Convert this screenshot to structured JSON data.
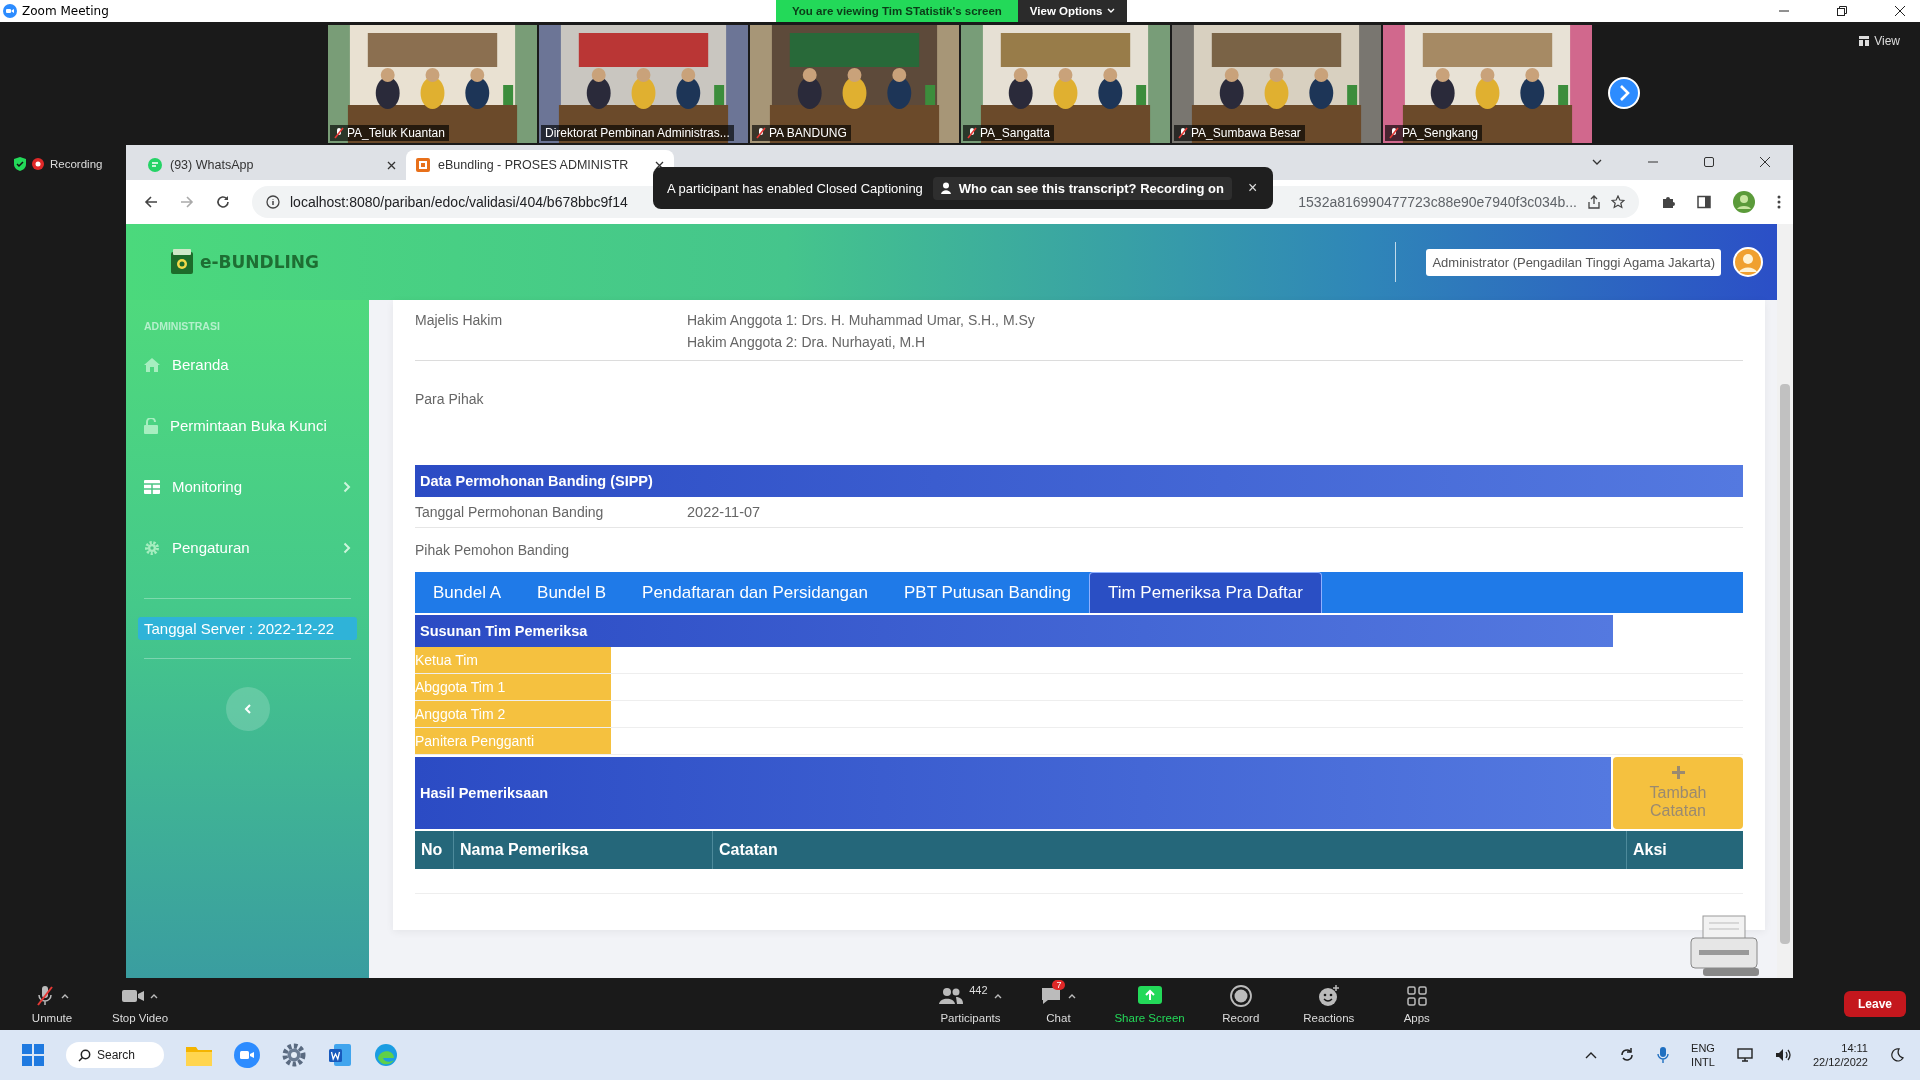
{
  "zoom_window": {
    "title": "Zoom Meeting",
    "banner": "You are viewing Tim STatistik's screen",
    "view_options": "View Options",
    "view": "View",
    "recording": "Recording"
  },
  "video_tiles": [
    {
      "name": "PA_Teluk Kuantan",
      "muted": true
    },
    {
      "name": "Direktorat Pembinan Administras...",
      "muted": false
    },
    {
      "name": "PA BANDUNG",
      "muted": true
    },
    {
      "name": "PA_Sangatta",
      "muted": true
    },
    {
      "name": "PA_Sumbawa Besar",
      "muted": true
    },
    {
      "name": "PA_Sengkang",
      "muted": true
    }
  ],
  "browser": {
    "tabs": [
      {
        "title": "(93) WhatsApp",
        "kind": "whatsapp",
        "selected": false
      },
      {
        "title": "eBundling - PROSES ADMINISTR",
        "kind": "ebundling",
        "selected": true
      }
    ],
    "url_start": "localhost:8080/pariban/edoc/validasi/404/b678bbc9f14",
    "url_end": "1532a816990477723c88e90e7940f3c034b..."
  },
  "caption_banner": {
    "text": "A participant has enabled Closed Captioning",
    "link": "Who can see this transcript? Recording on",
    "close": "×"
  },
  "app": {
    "logo": "e-BUNDLING",
    "user": "Administrator (Pengadilan Tinggi Agama Jakarta)"
  },
  "sidebar": {
    "section": "ADMINISTRASI",
    "items": [
      {
        "label": "Beranda",
        "kind": "home",
        "submenu": false
      },
      {
        "label": "Permintaan Buka Kunci",
        "kind": "lock",
        "submenu": false
      },
      {
        "label": "Monitoring",
        "kind": "grid",
        "submenu": true
      },
      {
        "label": "Pengaturan",
        "kind": "gear",
        "submenu": true
      }
    ],
    "server_date": "Tanggal Server : 2022-12-22"
  },
  "detail_rows": [
    {
      "label": "Majelis Hakim",
      "values": [
        "Hakim Anggota 1: Drs. H. Muhammad Umar, S.H., M.Sy",
        "Hakim Anggota 2: Dra. Nurhayati, M.H"
      ]
    },
    {
      "label": "Para Pihak"
    }
  ],
  "sipp": {
    "title": "Data Permohonan Banding (SIPP)",
    "rows": [
      {
        "label": "Tanggal Permohonan Banding",
        "value": "2022-11-07"
      },
      {
        "label": "Pihak Pemohon Banding"
      }
    ]
  },
  "tabs": [
    {
      "label": "Bundel A",
      "selected": false
    },
    {
      "label": "Bundel B",
      "selected": false
    },
    {
      "label": "Pendaftaran dan Persidangan",
      "selected": false
    },
    {
      "label": "PBT Putusan Banding",
      "selected": false
    },
    {
      "label": "Tim Pemeriksa Pra Daftar",
      "selected": true
    }
  ],
  "team": {
    "title": "Susunan Tim Pemeriksa",
    "roles": [
      "Ketua Tim",
      "Abggota Tim 1",
      "Anggota Tim 2",
      "Panitera Pengganti"
    ]
  },
  "results": {
    "title": "Hasil Pemeriksaan",
    "add_button": "Tambah Catatan",
    "columns": [
      "No",
      "Nama Pemeriksa",
      "Catatan",
      "Aksi"
    ]
  },
  "zoom_toolbar": {
    "items": [
      {
        "label": "Unmute",
        "kind": "mic-off",
        "caret": true
      },
      {
        "label": "Stop Video",
        "kind": "video",
        "caret": true
      },
      {
        "label": "Participants",
        "kind": "people",
        "count": "442",
        "caret": true
      },
      {
        "label": "Chat",
        "kind": "chat",
        "badge": "7",
        "caret": true
      },
      {
        "label": "Share Screen",
        "kind": "share",
        "caret": false
      },
      {
        "label": "Record",
        "kind": "record",
        "caret": false
      },
      {
        "label": "Reactions",
        "kind": "reactions",
        "caret": false
      },
      {
        "label": "Apps",
        "kind": "apps",
        "caret": false
      }
    ],
    "leave": "Leave"
  },
  "taskbar": {
    "search": "Search",
    "lang": "ENG",
    "layout": "INTL",
    "time": "14:11",
    "date": "22/12/2022"
  }
}
